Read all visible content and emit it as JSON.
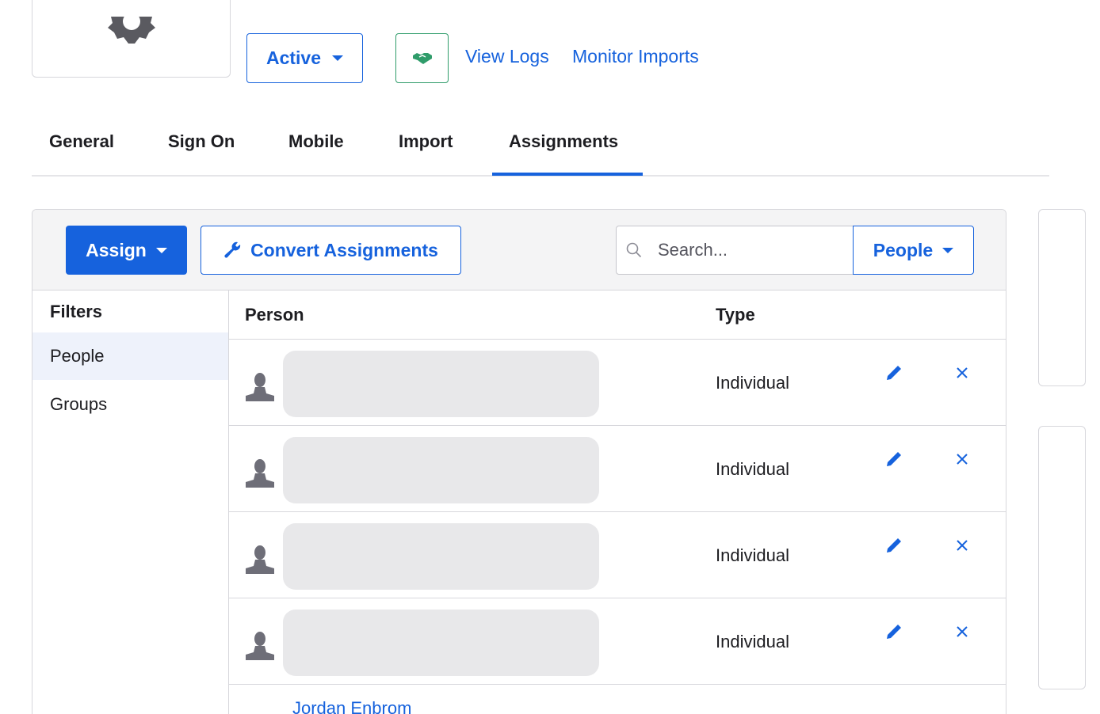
{
  "header": {
    "status_label": "Active",
    "links": [
      "View Logs",
      "Monitor Imports"
    ]
  },
  "tabs": [
    {
      "label": "General"
    },
    {
      "label": "Sign On"
    },
    {
      "label": "Mobile"
    },
    {
      "label": "Import"
    },
    {
      "label": "Assignments",
      "active": true
    }
  ],
  "toolbar": {
    "assign_label": "Assign",
    "convert_label": "Convert Assignments",
    "search_placeholder": "Search...",
    "scope_label": "People"
  },
  "filters": {
    "title": "Filters",
    "items": [
      {
        "label": "People",
        "active": true
      },
      {
        "label": "Groups"
      }
    ]
  },
  "table": {
    "columns": [
      "Person",
      "Type"
    ],
    "rows": [
      {
        "type": "Individual"
      },
      {
        "type": "Individual"
      },
      {
        "type": "Individual"
      },
      {
        "type": "Individual"
      }
    ],
    "partial_row_name": "Jordan Enbrom"
  },
  "colors": {
    "primary": "#1662dd",
    "success": "#2f9c6a",
    "icon_gray": "#6e6e78"
  }
}
